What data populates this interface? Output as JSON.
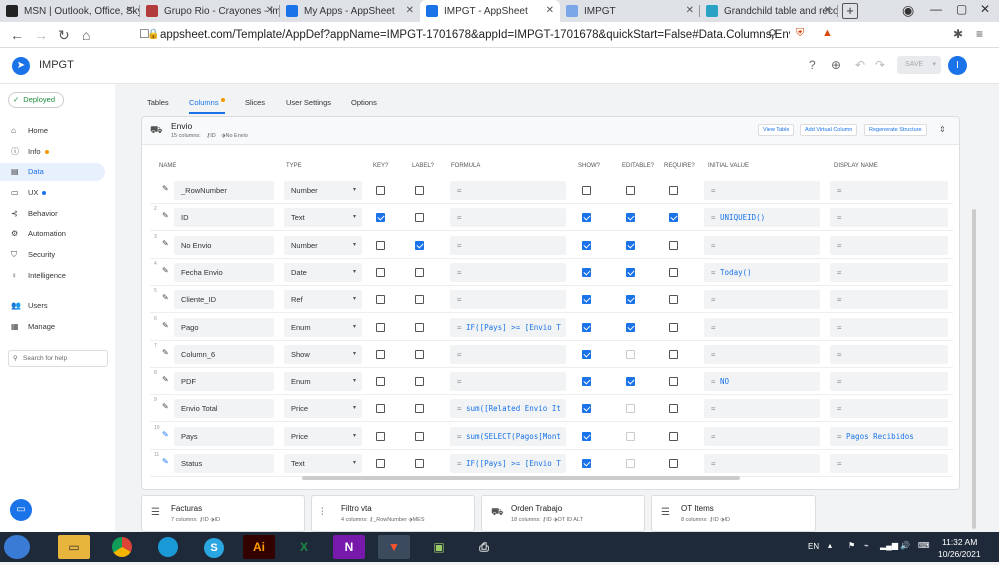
{
  "browser": {
    "tabs": [
      {
        "label": "MSN | Outlook, Office, Skype",
        "color": "#222222"
      },
      {
        "label": "Grupo Rio - Crayones - impre",
        "color": "#b23b3b"
      },
      {
        "label": "My Apps - AppSheet",
        "color": "#1a73e8"
      },
      {
        "label": "IMPGT - AppSheet",
        "color": "#1a73e8"
      },
      {
        "label": "IMPGT",
        "color": "#7aa7e8"
      },
      {
        "label": "Grandchild table and record",
        "color": "#2aa3c4"
      }
    ],
    "new_tab": "+",
    "url": "appsheet.com/Template/AppDef?appName=IMPGT-1701678&appId=IMPGT-1701678&quickStart=False#Data.Columns.Envi..."
  },
  "app": {
    "title": "IMPGT",
    "save_label": "SAVE",
    "avatar_letter": "I"
  },
  "sidebar": {
    "deployed": "Deployed",
    "items": [
      {
        "label": "Home",
        "icon": "home-icon",
        "glyph": "⌂"
      },
      {
        "label": "Info",
        "icon": "info-icon",
        "glyph": "ⓘ",
        "dot": "#f29900"
      },
      {
        "label": "Data",
        "icon": "data-icon",
        "glyph": "▤"
      },
      {
        "label": "UX",
        "icon": "ux-icon",
        "glyph": "▭",
        "dot": "#1a73e8"
      },
      {
        "label": "Behavior",
        "icon": "behavior-icon",
        "glyph": "⊰"
      },
      {
        "label": "Automation",
        "icon": "automation-icon",
        "glyph": "⚙"
      },
      {
        "label": "Security",
        "icon": "security-icon",
        "glyph": "⛉"
      },
      {
        "label": "Intelligence",
        "icon": "intelligence-icon",
        "glyph": "♀"
      },
      {
        "label": "Users",
        "icon": "users-icon",
        "glyph": "👥"
      },
      {
        "label": "Manage",
        "icon": "manage-icon",
        "glyph": "▦"
      }
    ],
    "search_placeholder": "Search for help"
  },
  "subtabs": [
    "Tables",
    "Columns",
    "Slices",
    "User Settings",
    "Options"
  ],
  "table": {
    "name": "Envio",
    "count": "15 columns:",
    "key_label": "ID",
    "label_label": "No Envio",
    "buttons": [
      "View Table",
      "Add Virtual Column",
      "Regenerate Structure"
    ]
  },
  "headers": [
    "NAME",
    "TYPE",
    "KEY?",
    "LABEL?",
    "FORMULA",
    "SHOW?",
    "EDITABLE?",
    "REQUIRE?",
    "INITIAL VALUE",
    "DISPLAY NAME"
  ],
  "rows": [
    {
      "num": "",
      "name": "_RowNumber",
      "type": "Number",
      "key": false,
      "label": false,
      "formula": "=",
      "show": false,
      "editable": false,
      "editable_dis": false,
      "require": false,
      "initial": "=",
      "display": "="
    },
    {
      "num": "2",
      "name": "ID",
      "type": "Text",
      "key": true,
      "label": false,
      "formula": "=",
      "show": true,
      "editable": true,
      "editable_dis": false,
      "require": true,
      "initial": "UNIQUEID()",
      "display": "="
    },
    {
      "num": "3",
      "name": "No Envio",
      "type": "Number",
      "key": false,
      "label": true,
      "formula": "=",
      "show": true,
      "editable": true,
      "editable_dis": false,
      "require": false,
      "initial": "=",
      "display": "="
    },
    {
      "num": "4",
      "name": "Fecha Envio",
      "type": "Date",
      "key": false,
      "label": false,
      "formula": "=",
      "show": true,
      "editable": true,
      "editable_dis": false,
      "require": false,
      "initial": "Today()",
      "display": "="
    },
    {
      "num": "5",
      "name": "Cliente_ID",
      "type": "Ref",
      "key": false,
      "label": false,
      "formula": "=",
      "show": true,
      "editable": true,
      "editable_dis": false,
      "require": false,
      "initial": "=",
      "display": "="
    },
    {
      "num": "6",
      "name": "Pago",
      "type": "Enum",
      "key": false,
      "label": false,
      "formula": "IF([Pays] >= [Envio T",
      "show": true,
      "editable": true,
      "editable_dis": false,
      "require": false,
      "initial": "=",
      "display": "="
    },
    {
      "num": "7",
      "name": "Column_6",
      "type": "Show",
      "key": false,
      "label": false,
      "formula": "=",
      "show": true,
      "editable": false,
      "editable_dis": true,
      "require": false,
      "initial": "=",
      "display": "="
    },
    {
      "num": "8",
      "name": "PDF",
      "type": "Enum",
      "key": false,
      "label": false,
      "formula": "=",
      "show": true,
      "editable": true,
      "editable_dis": false,
      "require": false,
      "initial": "NO",
      "display": "="
    },
    {
      "num": "9",
      "name": "Envio Total",
      "type": "Price",
      "key": false,
      "label": false,
      "formula": "sum([Related Envio It",
      "show": true,
      "editable": false,
      "editable_dis": true,
      "require": false,
      "initial": "=",
      "display": "="
    },
    {
      "num": "10",
      "name": "Pays",
      "type": "Price",
      "key": false,
      "label": false,
      "formula": "sum(SELECT(Pagos[Mont",
      "show": true,
      "editable": false,
      "editable_dis": true,
      "require": false,
      "initial": "=",
      "display": "Pagos Recibidos"
    },
    {
      "num": "11",
      "name": "Status",
      "type": "Text",
      "key": false,
      "label": false,
      "formula": "IF([Pays] >= [Envio T",
      "show": true,
      "editable": false,
      "editable_dis": true,
      "require": false,
      "initial": "=",
      "display": "="
    }
  ],
  "other_tables": [
    {
      "name": "Facturas",
      "count": "7 columns:",
      "key": "ID",
      "label": "ID"
    },
    {
      "name": "Filtro vta",
      "count": "4 columns:",
      "key": "_RowNumber",
      "label": "MES"
    },
    {
      "name": "Orden Trabajo",
      "count": "18 columns:",
      "key": "ID",
      "label": "OT ID ALT"
    },
    {
      "name": "OT Items",
      "count": "8 columns:",
      "key": "ID",
      "label": "ID"
    }
  ],
  "taskbar": {
    "lang": "EN",
    "time": "11:32 AM",
    "date": "10/26/2021"
  }
}
